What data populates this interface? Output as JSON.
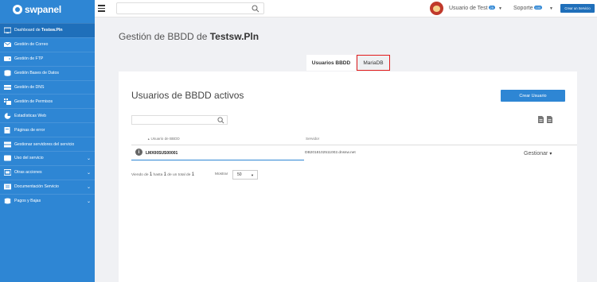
{
  "brand": {
    "logo_text": "swpanel"
  },
  "sidebar": {
    "items": [
      {
        "label_prefix": "Dashboard de ",
        "label_bold": "Testsw.Pln",
        "icon": "dashboard-icon",
        "active": true,
        "chevron": ""
      },
      {
        "label_prefix": "Gestión de Correo",
        "label_bold": "",
        "icon": "mail-icon",
        "active": false,
        "chevron": ""
      },
      {
        "label_prefix": "Gestión de FTP",
        "label_bold": "",
        "icon": "ftp-icon",
        "active": false,
        "chevron": ""
      },
      {
        "label_prefix": "Gestión Bases de Datos",
        "label_bold": "",
        "icon": "database-icon",
        "active": false,
        "chevron": ""
      },
      {
        "label_prefix": "Gestión de DNS",
        "label_bold": "",
        "icon": "dns-icon",
        "active": false,
        "chevron": ""
      },
      {
        "label_prefix": "Gestión de Permisos",
        "label_bold": "",
        "icon": "permissions-icon",
        "active": false,
        "chevron": ""
      },
      {
        "label_prefix": "Estadísticas Web",
        "label_bold": "",
        "icon": "stats-icon",
        "active": false,
        "chevron": ""
      },
      {
        "label_prefix": "Páginas de error",
        "label_bold": "",
        "icon": "error-pages-icon",
        "active": false,
        "chevron": ""
      },
      {
        "label_prefix": "Gestionar servidores del servicio",
        "label_bold": "",
        "icon": "servers-icon",
        "active": false,
        "chevron": ""
      },
      {
        "label_prefix": "Uso del servicio",
        "label_bold": "",
        "icon": "usage-icon",
        "active": false,
        "chevron": "⌄"
      },
      {
        "label_prefix": "Otras acciones",
        "label_bold": "",
        "icon": "actions-icon",
        "active": false,
        "chevron": "⌄"
      },
      {
        "label_prefix": "Documentación Servicio",
        "label_bold": "",
        "icon": "docs-icon",
        "active": false,
        "chevron": "⌄"
      },
      {
        "label_prefix": "Pagos y Bajas",
        "label_bold": "",
        "icon": "payments-icon",
        "active": false,
        "chevron": "⌄"
      }
    ]
  },
  "topbar": {
    "search_placeholder": "",
    "user_label": "Usuario de Test",
    "user_badge": "25",
    "support_label": "Soporte",
    "support_badge": "100",
    "new_service_label": "Crear un Servicio"
  },
  "page": {
    "title_prefix": "Gestión de BBDD de ",
    "title_bold": "Testsw.Pln"
  },
  "tabs": [
    {
      "label": "Usuarios BBDD",
      "active": true
    },
    {
      "label": "MariaDB",
      "active": false,
      "highlighted": true
    }
  ],
  "panel": {
    "title": "Usuarios de BBDD activos",
    "create_button": "Crear Usuario",
    "search_placeholder": "",
    "columns": {
      "user": "Usuario de BBDD",
      "server": "Servidor"
    },
    "rows": [
      {
        "user": "LMX00SUS00001",
        "server": "DB2018102511002.dnssw.net",
        "action": "Gestionar"
      }
    ],
    "footer": {
      "showing_text": "Viendo de ",
      "from": "1",
      "mid_text": " hasta ",
      "to": "1",
      "of_text": " de un total de ",
      "total": "1",
      "show_label": "Mostrar",
      "page_size": "50"
    }
  },
  "colors": {
    "sidebar": "#2e86d4",
    "accent": "#1f6fba",
    "highlight_border": "#e21b1b"
  }
}
